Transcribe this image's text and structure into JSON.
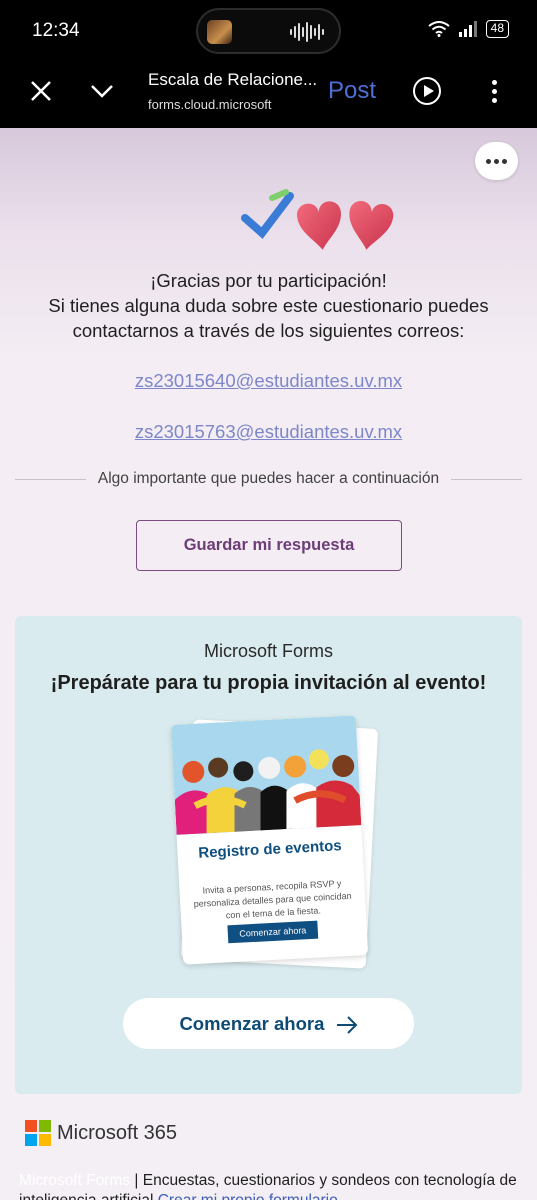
{
  "status": {
    "time": "12:34",
    "battery": "48"
  },
  "browser": {
    "title": "Escala de Relacione...",
    "url": "forms.cloud.microsoft",
    "post_label": "Post",
    "icons": [
      "close-icon",
      "chevron-down-icon",
      "play-icon",
      "more-vertical-icon"
    ]
  },
  "form": {
    "thanks_line1": "¡Gracias por tu participación!",
    "thanks_line2": "Si tienes alguna duda sobre este cuestionario puedes",
    "thanks_line3": "contactarnos a través de los siguientes correos:",
    "email1": "zs23015640@estudiantes.uv.mx",
    "email2": "zs23015763@estudiantes.uv.mx",
    "divider_text": "Algo importante que puedes hacer a continuación",
    "save_label": "Guardar mi respuesta"
  },
  "promo": {
    "brand": "Microsoft Forms",
    "headline": "¡Prepárate para tu propia invitación al evento!",
    "card_title": "Registro de eventos",
    "card_desc": "Invita a personas, recopila RSVP y personaliza detalles para que coincidan con el tema de la fiesta.",
    "card_button": "Comenzar ahora",
    "start_label": "Comenzar ahora"
  },
  "footer": {
    "ms365": "Microsoft 365",
    "brand": "Microsoft Forms",
    "text": " | Encuestas, cuestionarios y sondeos con tecnología de inteligencia artificial ",
    "link": "Crear mi propio formulario"
  },
  "colors": {
    "accent": "#6d3d78",
    "link": "#7c86c9",
    "promo_bg": "#d9ebee",
    "button_text": "#0e4b74"
  }
}
